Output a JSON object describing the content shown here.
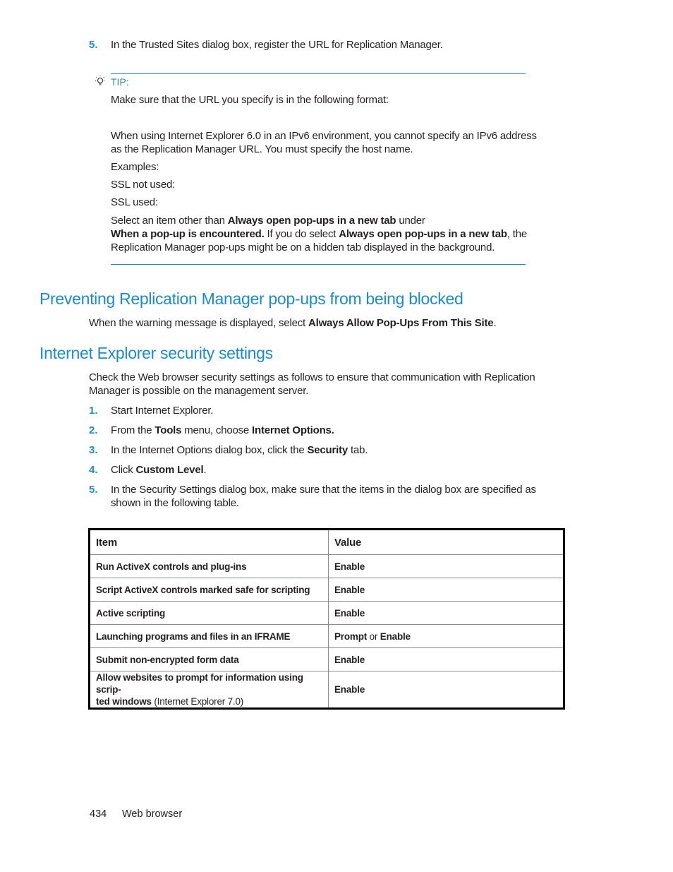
{
  "top_step": {
    "number": "5.",
    "text": "In the Trusted Sites dialog box, register the URL for Replication Manager."
  },
  "tip": {
    "icon": "lightbulb-icon",
    "label": "TIP:",
    "line1": "Make sure that the URL you specify is in the following format:",
    "ipv6_note_line1": "When using Internet Explorer 6.0 in an IPv6 environment, you cannot specify an IPv6 address",
    "ipv6_note_line2": "as the Replication Manager URL. You must specify the host name.",
    "examples": "Examples:",
    "ssl_not_used": "SSL not used:",
    "ssl_used": "SSL used:",
    "select_p1": "Select an item other than ",
    "select_b1": "Always open pop-ups in a new tab",
    "select_p2": " under",
    "select_b2": "When a pop-up is encountered.",
    "select_p3": " If you do select ",
    "select_b3": "Always open pop-ups in a new tab",
    "select_p4": ", the",
    "select_line3": "Replication Manager pop-ups might be on a hidden tab displayed in the background."
  },
  "section1": {
    "title": "Preventing Replication Manager pop-ups from being blocked",
    "text_prefix": "When the warning message is displayed, select ",
    "text_bold": "Always Allow Pop-Ups From This Site",
    "text_suffix": "."
  },
  "section2": {
    "title": "Internet Explorer security settings",
    "intro_line1": "Check the Web browser security settings as follows to ensure that communication with Replication",
    "intro_line2": "Manager is possible on the management server.",
    "steps": [
      {
        "number": "1.",
        "p1": "Start Internet Explorer."
      },
      {
        "number": "2.",
        "p1": "From the ",
        "b1": "Tools",
        "p2": " menu, choose ",
        "b2": "Internet Options."
      },
      {
        "number": "3.",
        "p1": "In the Internet Options dialog box, click the ",
        "b1": "Security",
        "p2": " tab."
      },
      {
        "number": "4.",
        "p1": "Click ",
        "b1": "Custom Level",
        "p2": "."
      },
      {
        "number": "5.",
        "line1": "In the Security Settings dialog box, make sure that the items in the dialog box are specified as",
        "line2": "shown in the following table."
      }
    ]
  },
  "table": {
    "headers": [
      "Item",
      "Value"
    ],
    "rows": [
      {
        "item": "Run ActiveX controls and plug-ins",
        "value": "Enable"
      },
      {
        "item": "Script ActiveX controls marked safe for scripting",
        "value": "Enable"
      },
      {
        "item": "Active scripting",
        "value": "Enable"
      },
      {
        "item": "Launching programs and files in an IFRAME",
        "value_b1": "Prompt",
        "value_p": " or ",
        "value_b2": "Enable"
      },
      {
        "item": "Submit non-encrypted form data",
        "value": "Enable"
      },
      {
        "item_line1": "Allow websites to prompt for information using scrip-",
        "item_line2_b": "ted windows",
        "item_line2_n": " (Internet Explorer 7.0)",
        "value": "Enable"
      }
    ]
  },
  "footer": {
    "page_number": "434",
    "section": "Web browser"
  }
}
